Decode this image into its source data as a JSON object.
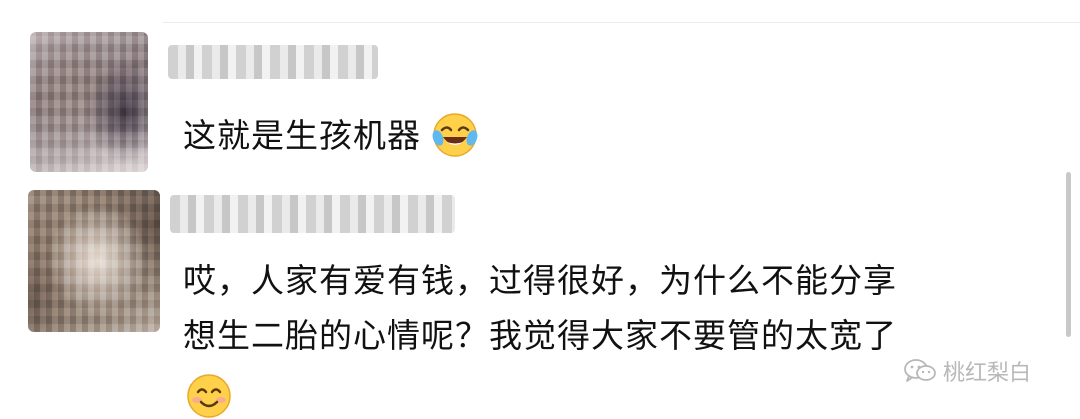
{
  "comments": [
    {
      "author_name_visible": false,
      "text": "这就是生孩机器",
      "trailing_emoji": "laugh-cry-emoji"
    },
    {
      "author_name_visible": false,
      "text_line1": "哎，人家有爱有钱，过得很好，为什么不能分享",
      "text_line2": "想生二胎的心情呢？我觉得大家不要管的太宽了",
      "trailing_emoji": "smile-emoji"
    }
  ],
  "watermark": {
    "label": "桃红梨白",
    "icon": "wechat-icon"
  },
  "colors": {
    "text": "#111111",
    "divider": "#ececec",
    "scrollbar": "#c8c8c8",
    "watermark": "#b8b8b8"
  }
}
